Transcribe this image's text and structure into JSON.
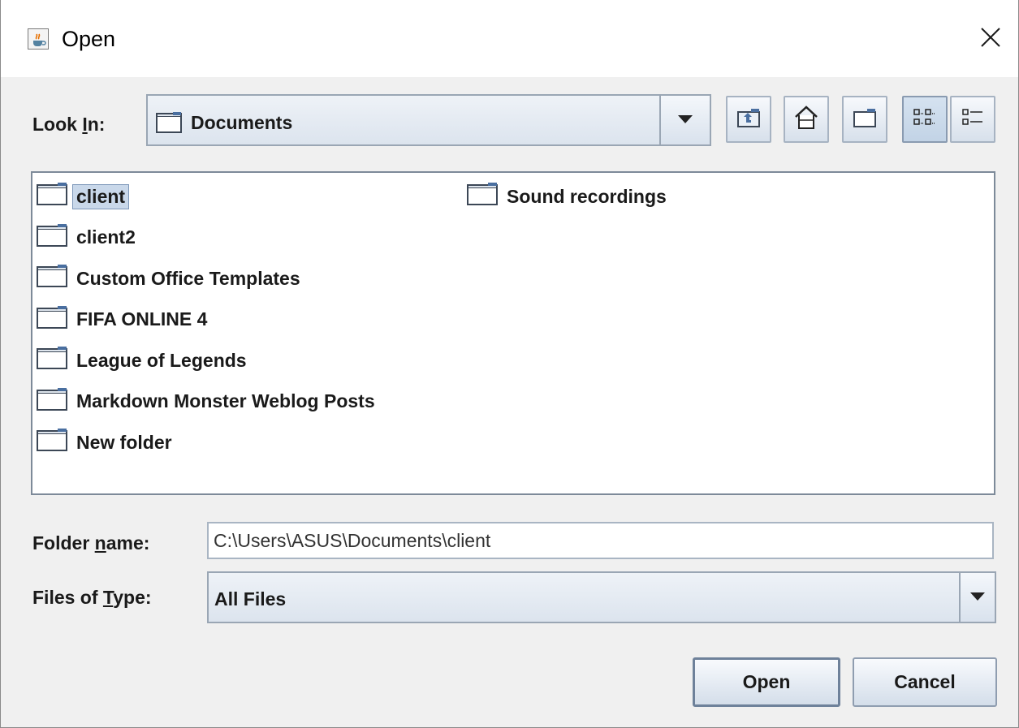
{
  "window": {
    "title": "Open",
    "app_icon": "java-cup-icon",
    "close_icon": "close-icon"
  },
  "look_in": {
    "label": "Look In:",
    "mnemonic": "I",
    "value": "Documents",
    "toolbar": [
      {
        "name": "up-one-level-button",
        "icon": "up-folder-icon"
      },
      {
        "name": "home-button",
        "icon": "home-icon"
      },
      {
        "name": "new-folder-button",
        "icon": "new-folder-icon"
      },
      {
        "name": "list-view-button",
        "icon": "list-view-icon",
        "pressed": true
      },
      {
        "name": "details-view-button",
        "icon": "details-view-icon",
        "pressed": false
      }
    ]
  },
  "files": {
    "items": [
      {
        "name": "client",
        "selected": true
      },
      {
        "name": "client2"
      },
      {
        "name": "Custom Office Templates"
      },
      {
        "name": "FIFA ONLINE 4"
      },
      {
        "name": "League of Legends"
      },
      {
        "name": "Markdown Monster Weblog Posts"
      },
      {
        "name": "New folder"
      },
      {
        "name": "Sound recordings"
      }
    ]
  },
  "folder_name": {
    "label": "Folder name:",
    "mnemonic": "n",
    "value": "C:\\Users\\ASUS\\Documents\\client"
  },
  "files_of_type": {
    "label": "Files of Type:",
    "mnemonic": "T",
    "value": "All Files"
  },
  "buttons": {
    "open": "Open",
    "cancel": "Cancel"
  },
  "colors": {
    "selection": "#c9d8ea",
    "background": "#f0f0f0"
  }
}
